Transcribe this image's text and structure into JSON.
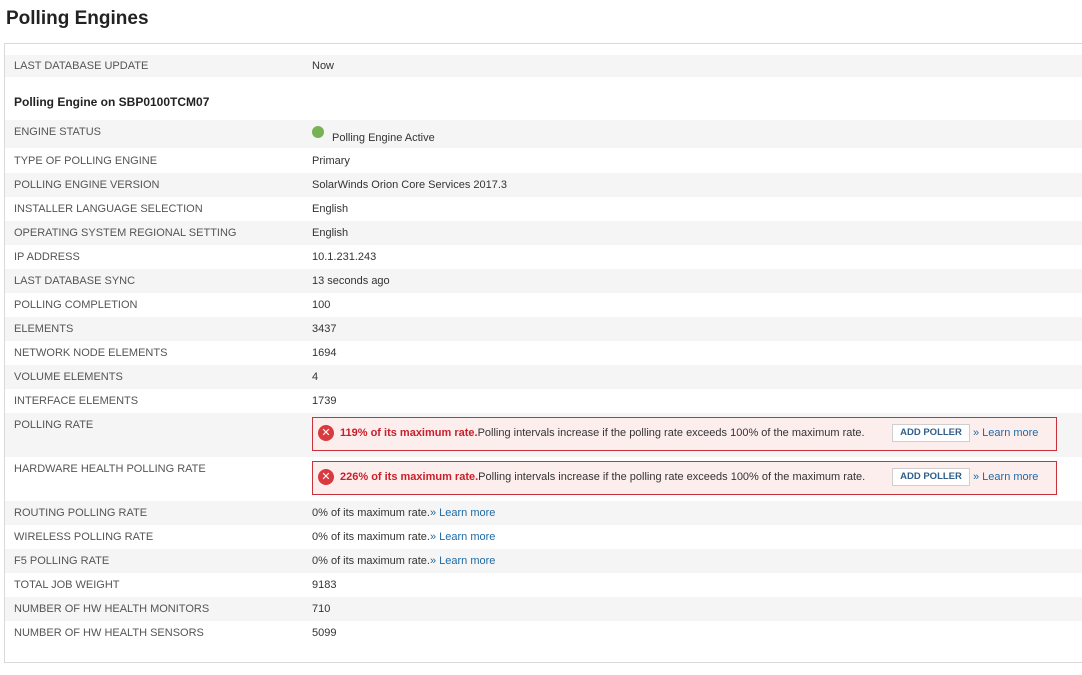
{
  "page": {
    "title": "Polling Engines"
  },
  "summary": {
    "label": "LAST DATABASE UPDATE",
    "value": "Now"
  },
  "engine": {
    "heading": "Polling Engine on SBP0100TCM07",
    "status": {
      "label": "ENGINE STATUS",
      "value": "Polling Engine Active",
      "status_color": "#77b255"
    },
    "rows": [
      {
        "label": "TYPE OF POLLING ENGINE",
        "value": "Primary"
      },
      {
        "label": "POLLING ENGINE VERSION",
        "value": "SolarWinds Orion Core Services 2017.3"
      },
      {
        "label": "INSTALLER LANGUAGE SELECTION",
        "value": "English"
      },
      {
        "label": "OPERATING SYSTEM REGIONAL SETTING",
        "value": "English"
      },
      {
        "label": "IP ADDRESS",
        "value": "10.1.231.243"
      },
      {
        "label": "LAST DATABASE SYNC",
        "value": "13 seconds ago"
      },
      {
        "label": "POLLING COMPLETION",
        "value": "100"
      },
      {
        "label": "ELEMENTS",
        "value": "3437"
      },
      {
        "label": "NETWORK NODE ELEMENTS",
        "value": "1694"
      },
      {
        "label": "VOLUME ELEMENTS",
        "value": "4"
      },
      {
        "label": "INTERFACE ELEMENTS",
        "value": "1739"
      }
    ],
    "alerts": [
      {
        "label": "POLLING RATE",
        "strong": "119% of its maximum rate.",
        "message": "Polling intervals increase if the polling rate exceeds 100% of the maximum rate.",
        "button": "ADD POLLER",
        "link": "» Learn more"
      },
      {
        "label": "HARDWARE HEALTH POLLING RATE",
        "strong": "226% of its maximum rate.",
        "message": "Polling intervals increase if the polling rate exceeds 100% of the maximum rate.",
        "button": "ADD POLLER",
        "link": "» Learn more"
      }
    ],
    "rate_rows": [
      {
        "label": "ROUTING POLLING RATE",
        "value": "0% of its maximum rate.",
        "link": "» Learn more"
      },
      {
        "label": "WIRELESS POLLING RATE",
        "value": "0% of its maximum rate.",
        "link": "» Learn more"
      },
      {
        "label": "F5 POLLING RATE",
        "value": "0% of its maximum rate.",
        "link": "» Learn more"
      }
    ],
    "tail_rows": [
      {
        "label": "TOTAL JOB WEIGHT",
        "value": "9183"
      },
      {
        "label": "NUMBER OF HW HEALTH MONITORS",
        "value": "710"
      },
      {
        "label": "NUMBER OF HW HEALTH SENSORS",
        "value": "5099"
      }
    ]
  },
  "colors": {
    "alert_border": "#c8323a",
    "alert_bg": "#fdeeee",
    "link": "#1f6aa5",
    "error_text": "#c8202a"
  }
}
